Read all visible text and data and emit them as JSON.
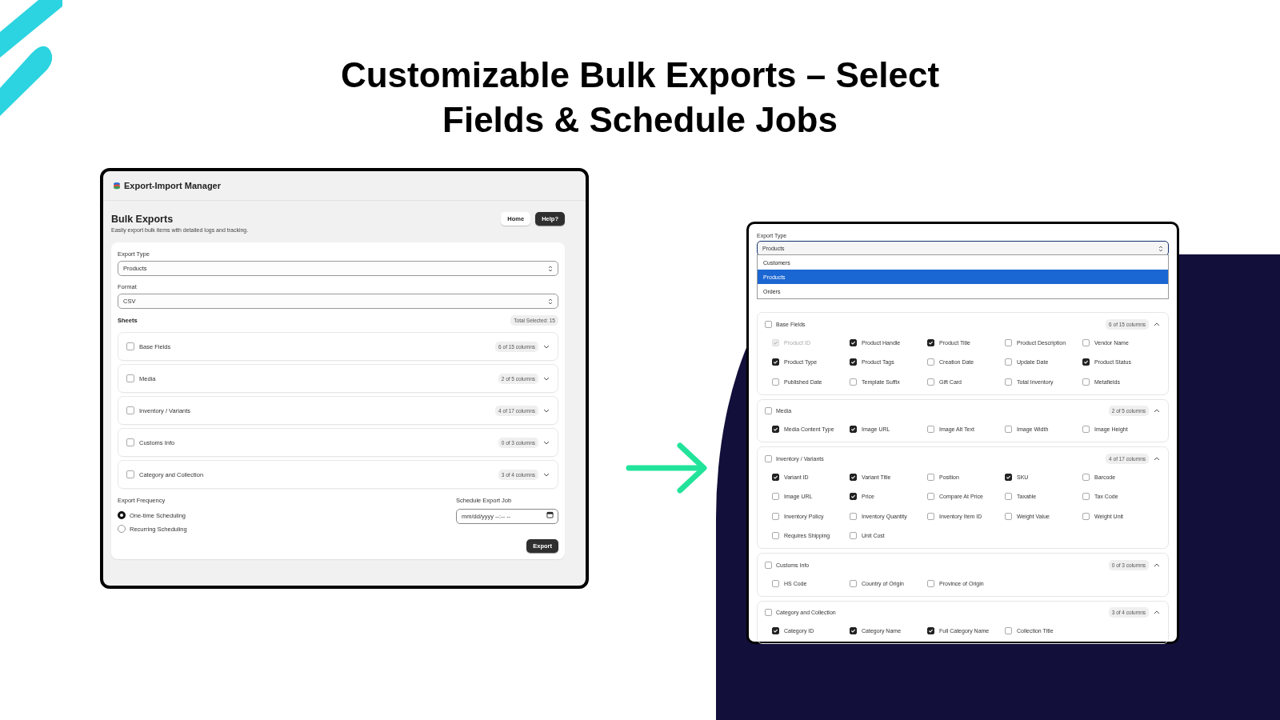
{
  "headline": "Customizable Bulk Exports – Select Fields & Schedule Jobs",
  "main_screen": {
    "app_title": "Export-Import Manager",
    "page_title": "Bulk Exports",
    "page_subtitle": "Easily export bulk items with detailed logs and tracking.",
    "buttons": [
      {
        "label": "Home",
        "kind": "secondary"
      },
      {
        "label": "Help?",
        "kind": "primary"
      }
    ],
    "export_type": {
      "label": "Export Type",
      "value": "Products"
    },
    "format": {
      "label": "Format",
      "value": "CSV"
    },
    "sheets_heading": "Sheets",
    "total_selected": "Total Selected: 15",
    "sheets": [
      {
        "name": "Base Fields",
        "checked": false,
        "count": "6 of 15 columns",
        "expanded": false
      },
      {
        "name": "Media",
        "checked": false,
        "count": "2 of 5 columns",
        "expanded": false
      },
      {
        "name": "Inventory / Variants",
        "checked": false,
        "count": "4 of 17 columns",
        "expanded": false
      },
      {
        "name": "Customs Info",
        "checked": false,
        "count": "0 of 3 columns",
        "expanded": false
      },
      {
        "name": "Category and Collection",
        "checked": false,
        "count": "3 of 4 columns",
        "expanded": false
      }
    ],
    "frequency": {
      "label": "Export Frequency",
      "options": [
        {
          "label": "One-time Scheduling",
          "selected": true
        },
        {
          "label": "Recurring Scheduling",
          "selected": false
        }
      ]
    },
    "schedule": {
      "label": "Schedule Export Job",
      "placeholder": "mm/dd/yyyy --:-- --"
    },
    "export_button": "Export"
  },
  "detail_screen": {
    "export_type": {
      "label": "Export Type",
      "value": "Products"
    },
    "dropdown_options": [
      {
        "label": "Customers",
        "selected": false
      },
      {
        "label": "Products",
        "selected": true
      },
      {
        "label": "Orders",
        "selected": false
      }
    ],
    "sheets": [
      {
        "name": "Base Fields",
        "checked": false,
        "count": "6 of 15 columns",
        "expanded": true,
        "fields": [
          {
            "label": "Product ID",
            "checked": true,
            "disabled": true
          },
          {
            "label": "Product Handle",
            "checked": true,
            "disabled": false
          },
          {
            "label": "Product Title",
            "checked": true,
            "disabled": false
          },
          {
            "label": "Product Description",
            "checked": false,
            "disabled": false
          },
          {
            "label": "Vendor Name",
            "checked": false,
            "disabled": false
          },
          {
            "label": "Product Type",
            "checked": true,
            "disabled": false
          },
          {
            "label": "Product Tags",
            "checked": true,
            "disabled": false
          },
          {
            "label": "Creation Date",
            "checked": false,
            "disabled": false
          },
          {
            "label": "Update Date",
            "checked": false,
            "disabled": false
          },
          {
            "label": "Product Status",
            "checked": true,
            "disabled": false
          },
          {
            "label": "Published Date",
            "checked": false,
            "disabled": false
          },
          {
            "label": "Template Suffix",
            "checked": false,
            "disabled": false
          },
          {
            "label": "Gift Card",
            "checked": false,
            "disabled": false
          },
          {
            "label": "Total Inventory",
            "checked": false,
            "disabled": false
          },
          {
            "label": "Metafields",
            "checked": false,
            "disabled": false
          }
        ]
      },
      {
        "name": "Media",
        "checked": false,
        "count": "2 of 5 columns",
        "expanded": true,
        "fields": [
          {
            "label": "Media Content Type",
            "checked": true,
            "disabled": false
          },
          {
            "label": "Image URL",
            "checked": true,
            "disabled": false
          },
          {
            "label": "Image Alt Text",
            "checked": false,
            "disabled": false
          },
          {
            "label": "Image Width",
            "checked": false,
            "disabled": false
          },
          {
            "label": "Image Height",
            "checked": false,
            "disabled": false
          }
        ]
      },
      {
        "name": "Inventory / Variants",
        "checked": false,
        "count": "4 of 17 columns",
        "expanded": true,
        "fields": [
          {
            "label": "Variant ID",
            "checked": true,
            "disabled": false
          },
          {
            "label": "Variant Title",
            "checked": true,
            "disabled": false
          },
          {
            "label": "Position",
            "checked": false,
            "disabled": false
          },
          {
            "label": "SKU",
            "checked": true,
            "disabled": false
          },
          {
            "label": "Barcode",
            "checked": false,
            "disabled": false
          },
          {
            "label": "Image URL",
            "checked": false,
            "disabled": false
          },
          {
            "label": "Price",
            "checked": true,
            "disabled": false
          },
          {
            "label": "Compare At Price",
            "checked": false,
            "disabled": false
          },
          {
            "label": "Taxable",
            "checked": false,
            "disabled": false
          },
          {
            "label": "Tax Code",
            "checked": false,
            "disabled": false
          },
          {
            "label": "Inventory Policy",
            "checked": false,
            "disabled": false
          },
          {
            "label": "Inventory Quantity",
            "checked": false,
            "disabled": false
          },
          {
            "label": "Inventory Item ID",
            "checked": false,
            "disabled": false
          },
          {
            "label": "Weight Value",
            "checked": false,
            "disabled": false
          },
          {
            "label": "Weight Unit",
            "checked": false,
            "disabled": false
          },
          {
            "label": "Requires Shipping",
            "checked": false,
            "disabled": false
          },
          {
            "label": "Unit Cost",
            "checked": false,
            "disabled": false
          }
        ]
      },
      {
        "name": "Customs Info",
        "checked": false,
        "count": "0 of 3 columns",
        "expanded": true,
        "fields": [
          {
            "label": "HS Code",
            "checked": false,
            "disabled": false
          },
          {
            "label": "Country of Origin",
            "checked": false,
            "disabled": false
          },
          {
            "label": "Province of Origin",
            "checked": false,
            "disabled": false
          }
        ]
      },
      {
        "name": "Category and Collection",
        "checked": false,
        "count": "3 of 4 columns",
        "expanded": true,
        "fields": [
          {
            "label": "Category ID",
            "checked": true,
            "disabled": false
          },
          {
            "label": "Category Name",
            "checked": true,
            "disabled": false
          },
          {
            "label": "Full Category Name",
            "checked": true,
            "disabled": false
          },
          {
            "label": "Collection Title",
            "checked": false,
            "disabled": false
          }
        ]
      }
    ]
  }
}
